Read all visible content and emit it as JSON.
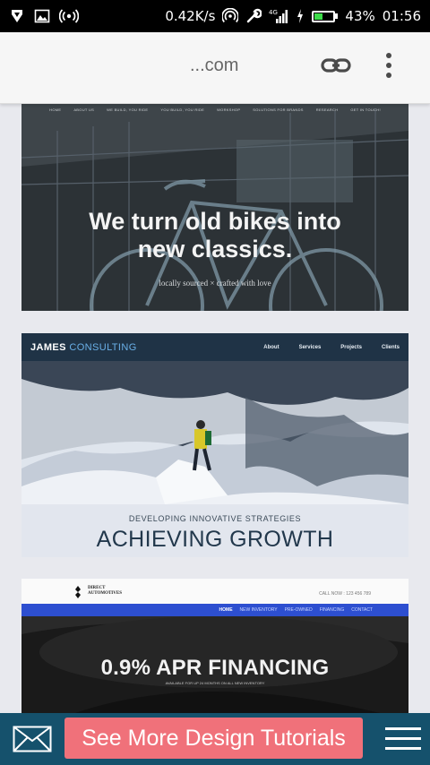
{
  "status_bar": {
    "speed": "0.42K/s",
    "network": "4G",
    "battery_percent": 43,
    "battery_text": "43%",
    "time": "01:56",
    "icons": [
      "tango-icon",
      "image-icon",
      "broadcast-icon",
      "hotspot-icon",
      "wrench-icon",
      "signal-icon",
      "charging-icon",
      "battery-icon"
    ]
  },
  "browser": {
    "url": "...com",
    "link_icon": "link-icon",
    "menu_icon": "overflow-menu-icon"
  },
  "cards": {
    "bikes": {
      "nav": [
        "HOME",
        "ABOUT US",
        "WE BUILD, YOU RIDE",
        "YOU BUILD, YOU RIDE",
        "WORKSHOP",
        "SOLUTIONS FOR BRANDS",
        "RESEARCH",
        "GET IN TOUCH!"
      ],
      "headline_line1": "We turn old bikes into",
      "headline_line2": "new classics.",
      "tagline": "locally sourced × crafted with love"
    },
    "consulting": {
      "brand_main": "JAMES",
      "brand_accent": "CONSULTING",
      "nav": [
        "About",
        "Services",
        "Projects",
        "Clients"
      ],
      "subheading": "DEVELOPING INNOVATIVE STRATEGIES",
      "heading": "ACHIEVING GROWTH"
    },
    "automotive": {
      "brand_line1": "DIRECT",
      "brand_line2": "AUTOMOTIVES",
      "call": "CALL NOW : 123 456 789",
      "nav": [
        "HOME",
        "NEW INVENTORY",
        "PRE-OWNED",
        "FINANCING",
        "CONTACT"
      ],
      "headline": "0.9% APR FINANCING",
      "subline": "AVAILABLE FOR UP 24 MONTHS ON ALL NEW INVENTORY"
    }
  },
  "bottom_bar": {
    "cta_label": "See More Design Tutorials",
    "mail_icon": "mail-icon",
    "menu_icon": "hamburger-menu-icon",
    "cta_color": "#f0717a",
    "bar_color": "#15516c"
  }
}
